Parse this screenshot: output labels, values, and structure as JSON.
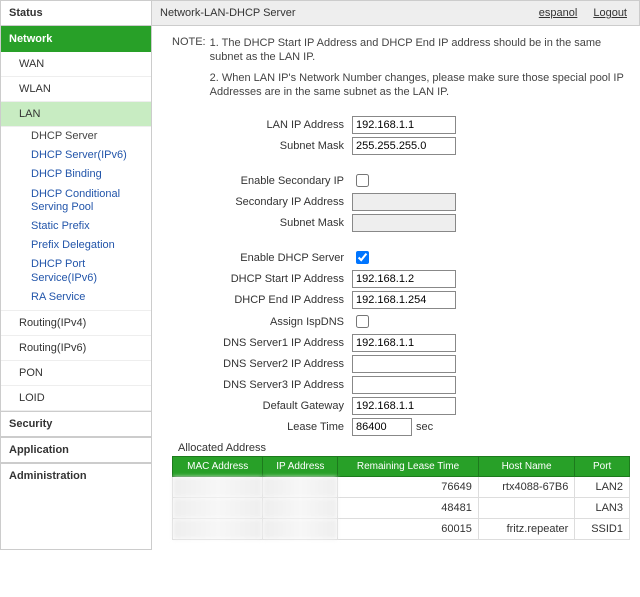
{
  "breadcrumb": "Network-LAN-DHCP Server",
  "language_link": "espanol",
  "logout_link": "Logout",
  "sidebar": {
    "status": "Status",
    "network": "Network",
    "expanded": {
      "wan": "WAN",
      "wlan": "WLAN",
      "lan": "LAN",
      "lan_children": [
        "DHCP Server",
        "DHCP Server(IPv6)",
        "DHCP Binding",
        "DHCP Conditional Serving Pool",
        "Static Prefix",
        "Prefix Delegation",
        "DHCP Port Service(IPv6)",
        "RA Service"
      ],
      "routing4": "Routing(IPv4)",
      "routing6": "Routing(IPv6)",
      "pon": "PON",
      "loid": "LOID"
    },
    "security": "Security",
    "application": "Application",
    "administration": "Administration"
  },
  "note_label": "NOTE:",
  "note1": "1. The DHCP Start IP Address and DHCP End IP address should be in the same subnet as the LAN IP.",
  "note2": "2. When LAN IP's Network Number changes, please make sure those special pool IP Addresses are in the same subnet as the LAN IP.",
  "form": {
    "lan_ip_label": "LAN IP Address",
    "lan_ip_value": "192.168.1.1",
    "subnet_label": "Subnet Mask",
    "subnet_value": "255.255.255.0",
    "enable_sec_label": "Enable Secondary IP",
    "sec_ip_label": "Secondary IP Address",
    "sec_ip_value": "",
    "sec_subnet_label": "Subnet Mask",
    "sec_subnet_value": "",
    "enable_dhcp_label": "Enable DHCP Server",
    "start_label": "DHCP Start IP Address",
    "start_value": "192.168.1.2",
    "end_label": "DHCP End IP Address",
    "end_value": "192.168.1.254",
    "isp_dns_label": "Assign IspDNS",
    "dns1_label": "DNS Server1 IP Address",
    "dns1_value": "192.168.1.1",
    "dns2_label": "DNS Server2 IP Address",
    "dns2_value": "",
    "dns3_label": "DNS Server3 IP Address",
    "dns3_value": "",
    "gateway_label": "Default Gateway",
    "gateway_value": "192.168.1.1",
    "lease_label": "Lease Time",
    "lease_value": "86400",
    "lease_unit": "sec"
  },
  "allocated_title": "Allocated Address",
  "alloc_headers": [
    "MAC Address",
    "IP Address",
    "Remaining Lease Time",
    "Host Name",
    "Port"
  ],
  "alloc_rows": [
    {
      "rem": "76649",
      "host": "rtx4088-67B6",
      "port": "LAN2"
    },
    {
      "rem": "48481",
      "host": "",
      "port": "LAN3"
    },
    {
      "rem": "60015",
      "host": "fritz.repeater",
      "port": "SSID1"
    }
  ]
}
